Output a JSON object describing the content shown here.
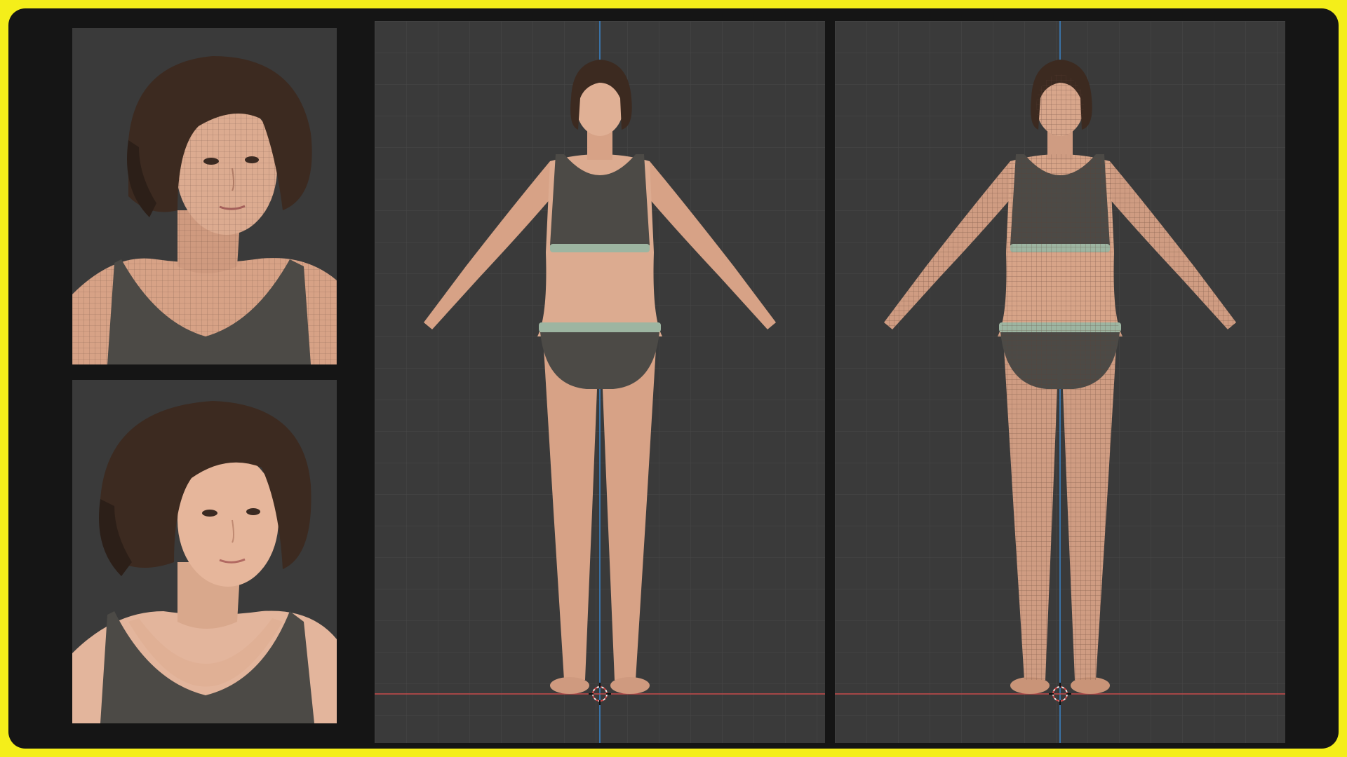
{
  "colors": {
    "outer_border": "#f4ee1a",
    "frame_background": "#151515",
    "viewport_background": "#3a3a3a",
    "grid_minor": "#454545",
    "grid_major": "#505050",
    "axis_y": "#3b84c9",
    "axis_x": "#c84a4a",
    "skin": "#d8a78b",
    "skin_shadow": "#b98268",
    "hair": "#3c2a20",
    "garment": "#4c4a46",
    "waistband": "#9db5a1"
  },
  "panels": [
    {
      "id": "closeup-wireframe",
      "kind": "closeup",
      "shading": "textured-wireframe"
    },
    {
      "id": "closeup-shaded",
      "kind": "closeup",
      "shading": "textured"
    },
    {
      "id": "viewport-shaded",
      "kind": "full-body-front",
      "shading": "textured"
    },
    {
      "id": "viewport-wireframe",
      "kind": "full-body-front",
      "shading": "textured-wireframe"
    }
  ],
  "icons": {
    "cursor": "3d-cursor-icon"
  }
}
